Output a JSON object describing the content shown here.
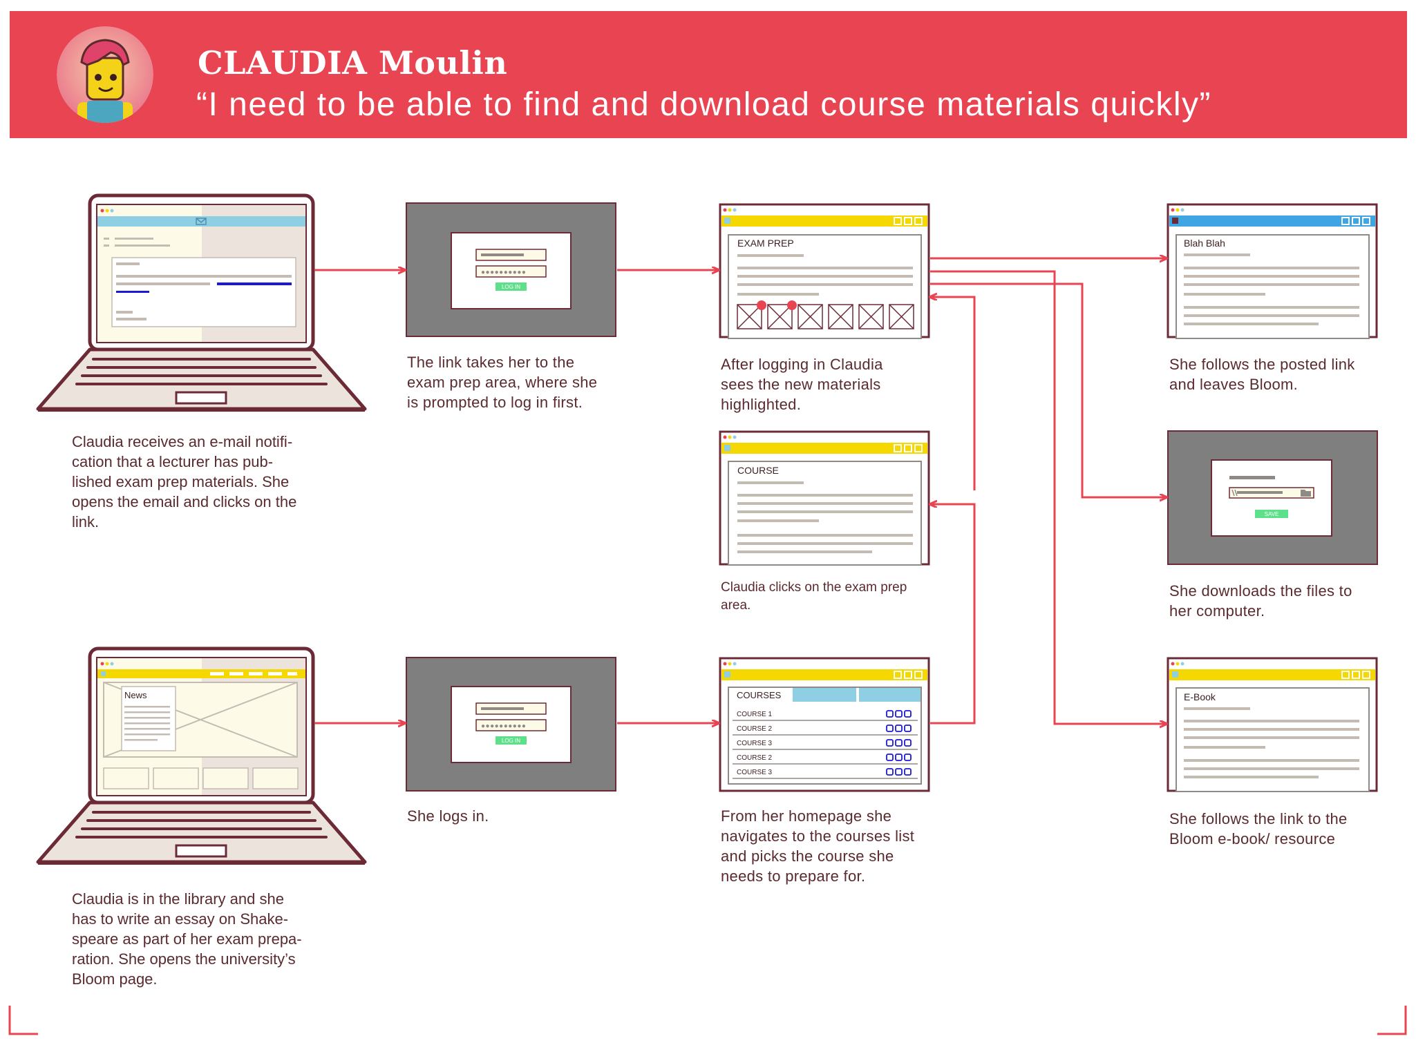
{
  "header": {
    "name": "CLAUDIA Moulin",
    "quote": "“I need to be able to find and download course materials quickly”"
  },
  "colors": {
    "header_bg": "#e84451",
    "arrow": "#e84451",
    "outline": "#6b2a35",
    "browser_yellow": "#f5d800",
    "browser_blue": "#8ecfe3",
    "dark_panel": "#7f7f7f",
    "button_green": "#5ee08a",
    "link_blue": "#1a1ad6"
  },
  "steps": {
    "email": {
      "caption": "Claudia receives an e-mail notifi-\ncation that a lecturer has pub-\nlished exam prep materials. She\nopens the email and clicks on the\nlink."
    },
    "login1": {
      "caption": "The link takes her to the\nexam prep area, where she\nis prompted to log in first.",
      "button": "LOG IN"
    },
    "exam_prep": {
      "caption": "After logging in Claudia\nsees the new materials\nhighlighted.",
      "title": "EXAM PREP"
    },
    "course": {
      "caption": "Claudia clicks on the exam prep\narea.",
      "title": "COURSE"
    },
    "external": {
      "caption": "She follows the posted link\nand leaves Bloom.",
      "title": "Blah Blah"
    },
    "download": {
      "caption": "She downloads the files to\nher computer.",
      "button": "SAVE"
    },
    "ebook": {
      "caption": "She follows the link to the\nBloom e-book/ resource",
      "title": "E-Book"
    },
    "library": {
      "caption": "Claudia is in the library and she\nhas to write an essay on Shake-\nspeare as part of her exam prepa-\nration. She opens the university’s\nBloom page.",
      "news_label": "News"
    },
    "login2": {
      "caption": "She logs in.",
      "button": "LOG IN"
    },
    "courses": {
      "caption": "From her homepage she\nnavigates to the courses list\nand picks the course she\nneeds to prepare for.",
      "title": "COURSES",
      "rows": [
        "COURSE 1",
        "COURSE 2",
        "COURSE 3",
        "COURSE 2",
        "COURSE 3"
      ]
    }
  }
}
